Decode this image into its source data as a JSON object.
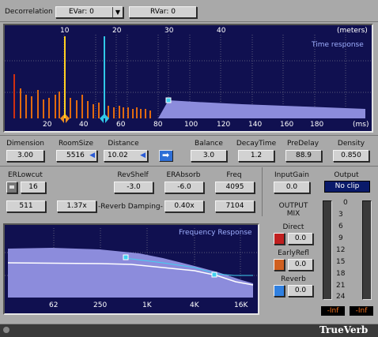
{
  "top": {
    "decorrelation_label": "Decorrelation",
    "evar": "EVar: 0",
    "rvar": "RVar: 0"
  },
  "time_response": {
    "title": "Time response",
    "meters_label": "(meters)",
    "meters_ticks": [
      "10",
      "20",
      "30",
      "40"
    ],
    "ms_label": "(ms)",
    "ms_ticks": [
      "20",
      "40",
      "60",
      "80",
      "100",
      "120",
      "140",
      "160",
      "180"
    ]
  },
  "params": {
    "dimension_label": "Dimension",
    "dimension": "3.00",
    "roomsize_label": "RoomSize",
    "roomsize": "5516",
    "distance_label": "Distance",
    "distance": "10.02",
    "balance_label": "Balance",
    "balance": "3.0",
    "decaytime_label": "DecayTime",
    "decaytime": "1.2",
    "predelay_label": "PreDelay",
    "predelay": "88.9",
    "density_label": "Density",
    "density": "0.850"
  },
  "eq": {
    "erlowcut_label": "ERLowcut",
    "erlowcut": "16",
    "revshelf_label": "RevShelf",
    "revshelf": "-3.0",
    "erabsorb_label": "ERAbsorb",
    "erabsorb": "-6.0",
    "freq_label": "Freq",
    "freq": "4095",
    "v511": "511",
    "v137": "1.37x",
    "damping_label": "-Reverb Damping-",
    "v040": "0.40x",
    "v7104": "7104"
  },
  "freq_response": {
    "title": "Frequency Response",
    "ticks": [
      "62",
      "250",
      "1K",
      "4K",
      "16K"
    ]
  },
  "output": {
    "inputgain_label": "InputGain",
    "inputgain": "0.0",
    "output_label": "Output",
    "output_state": "No clip",
    "mix_label_1": "OUTPUT",
    "mix_label_2": "MIX",
    "direct_label": "Direct",
    "direct": "0.0",
    "earlyrefl_label": "EarlyRefl",
    "earlyrefl": "0.0",
    "reverb_label": "Reverb",
    "reverb": "0.0",
    "meter_scale": [
      "0",
      "3",
      "6",
      "9",
      "12",
      "15",
      "18",
      "21",
      "24"
    ],
    "meter_left": "-Inf",
    "meter_right": "-Inf"
  },
  "brand": "TrueVerb"
}
